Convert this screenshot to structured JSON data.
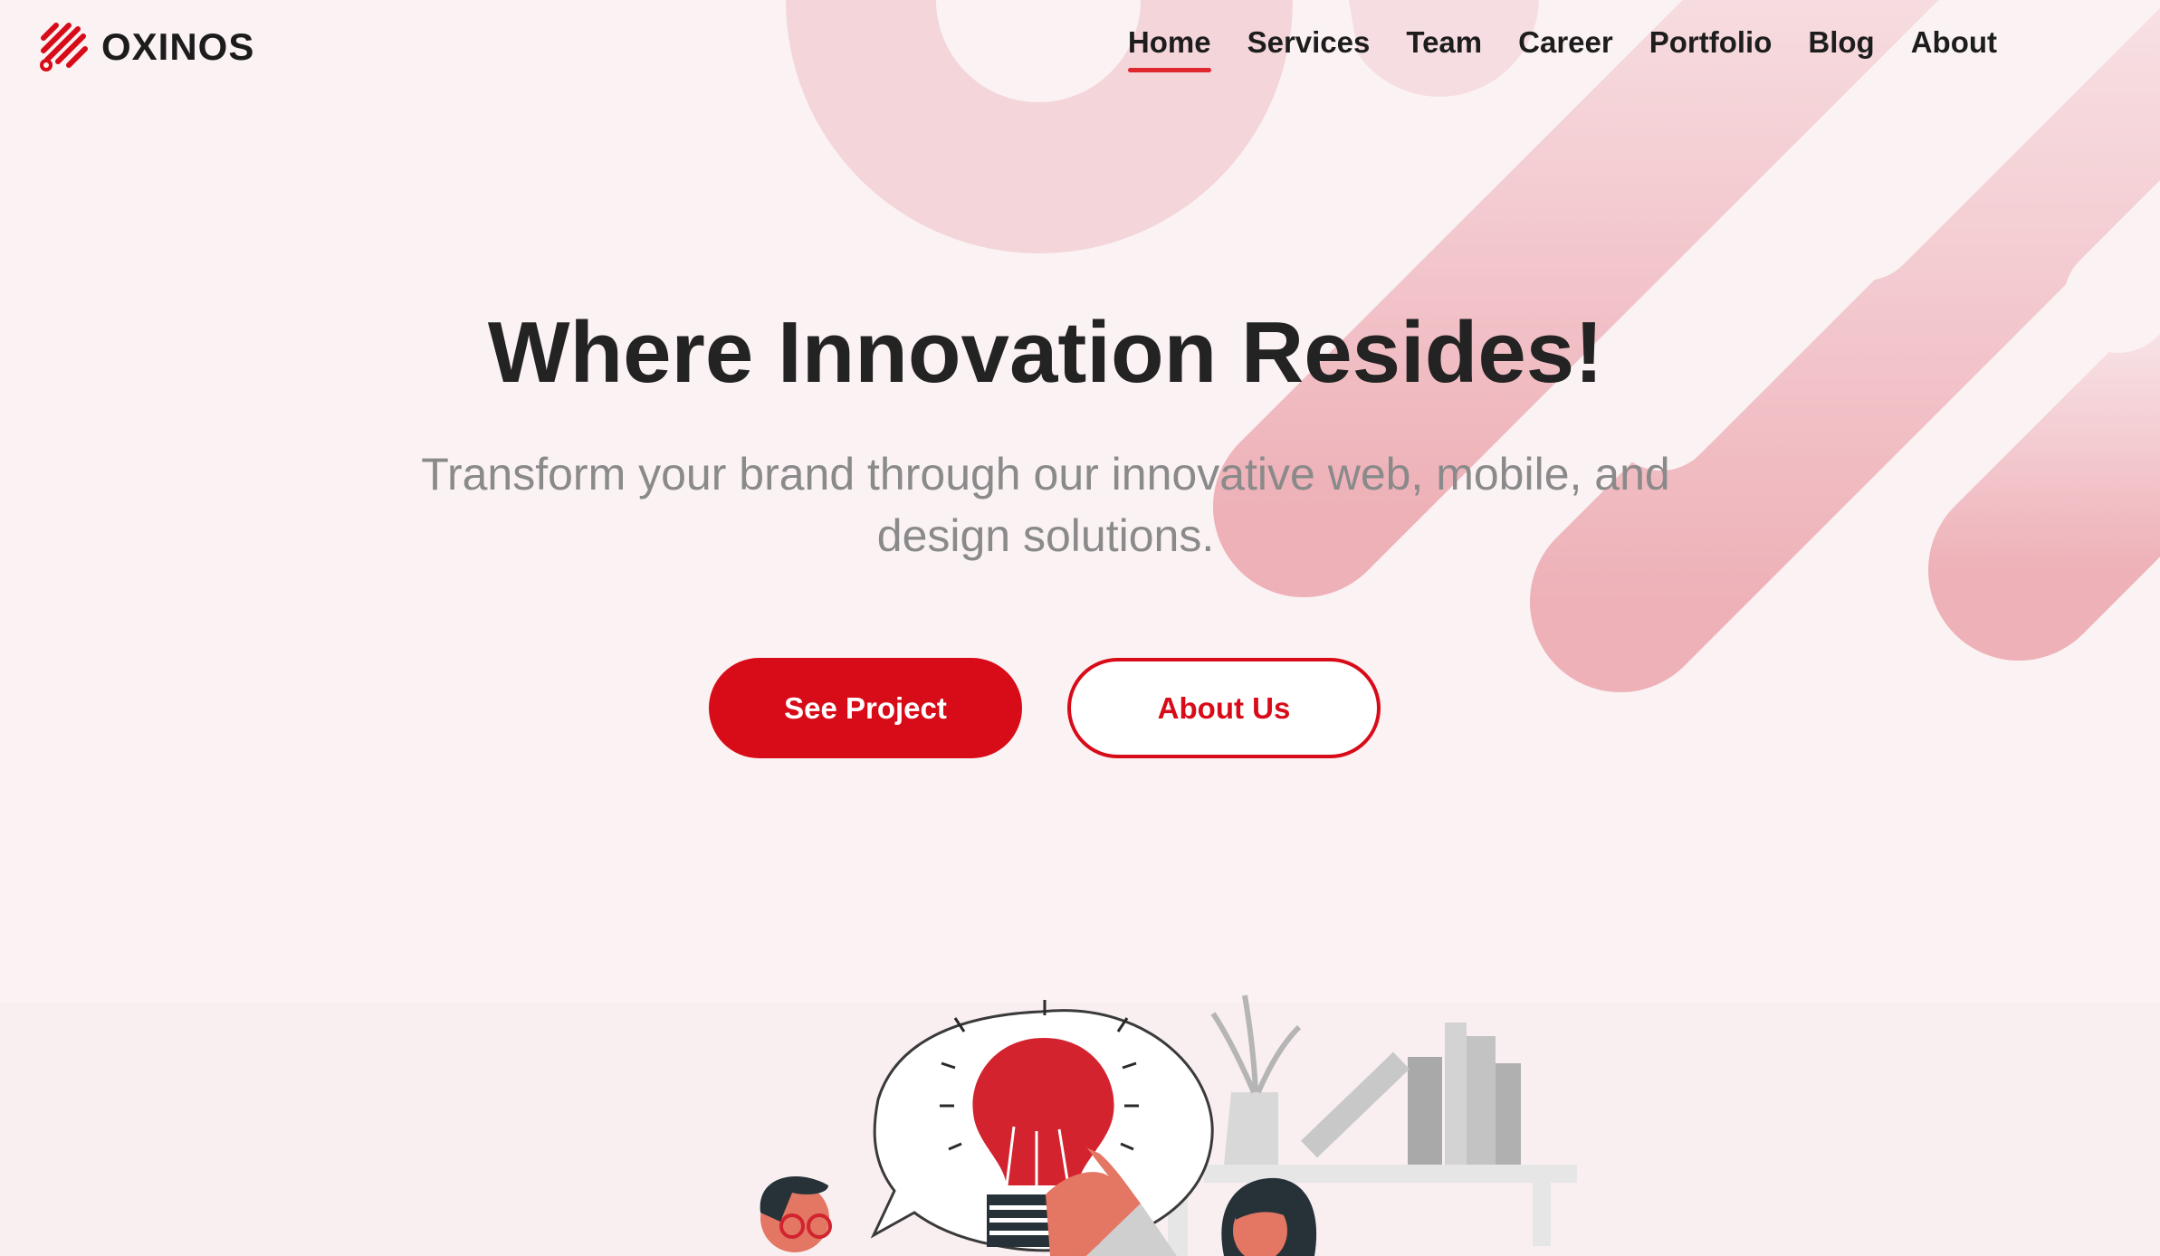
{
  "brand": {
    "name": "OXINOS",
    "accent": "#d80b18"
  },
  "nav": {
    "active": "Home",
    "items": [
      {
        "label": "Home"
      },
      {
        "label": "Services"
      },
      {
        "label": "Team"
      },
      {
        "label": "Career"
      },
      {
        "label": "Portfolio"
      },
      {
        "label": "Blog"
      },
      {
        "label": "About"
      }
    ]
  },
  "hero": {
    "title": "Where Innovation Resides!",
    "subtitle": "Transform your brand through our innovative web, mobile, and design solutions.",
    "primary_button": "See Project",
    "secondary_button": "About Us"
  },
  "illustration": {
    "icon": "lightbulb-idea-illustration"
  }
}
